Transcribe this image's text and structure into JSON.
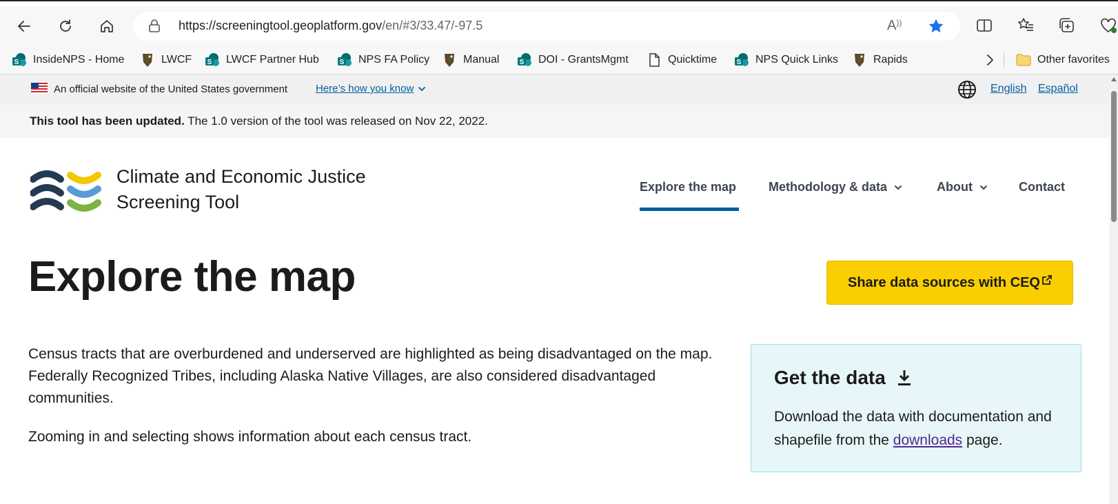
{
  "browser": {
    "url_host": "https://screeningtool.geoplatform.gov",
    "url_path": "/en/#3/33.47/-97.5",
    "read_aloud_label": "A",
    "favorites": [
      {
        "label": "InsideNPS - Home",
        "icon": "sharepoint-icon"
      },
      {
        "label": "LWCF",
        "icon": "nps-arrowhead-icon"
      },
      {
        "label": "LWCF Partner Hub",
        "icon": "sharepoint-icon"
      },
      {
        "label": "NPS FA Policy",
        "icon": "sharepoint-icon"
      },
      {
        "label": "Manual",
        "icon": "nps-arrowhead-icon"
      },
      {
        "label": "DOI - GrantsMgmt",
        "icon": "sharepoint-icon"
      },
      {
        "label": "Quicktime",
        "icon": "document-icon"
      },
      {
        "label": "NPS Quick Links",
        "icon": "sharepoint-icon"
      },
      {
        "label": "Rapids",
        "icon": "nps-arrowhead-icon"
      }
    ],
    "other_favorites": "Other favorites"
  },
  "gov_banner": {
    "text": "An official website of the United States government",
    "link": "Here’s how you know",
    "lang_english": "English",
    "lang_spanish": "Español"
  },
  "update_notice": {
    "bold": "This tool has been updated.",
    "text": " The 1.0 version of the tool was released on Nov 22, 2022."
  },
  "header": {
    "title_line1": "Climate and Economic Justice",
    "title_line2": "Screening Tool",
    "nav": {
      "explore": "Explore the map",
      "methodology": "Methodology & data",
      "about": "About",
      "contact": "Contact"
    }
  },
  "main": {
    "heading": "Explore the map",
    "share_button": "Share data sources with CEQ",
    "intro": "Census tracts that are overburdened and underserved are highlighted as being disadvantaged on the map. Federally Recognized Tribes, including Alaska Native Villages, are also considered disadvantaged communities.",
    "intro2": "Zooming in and selecting shows information about each census tract."
  },
  "get_data_card": {
    "title": "Get the data",
    "body_before": "Download the data with documentation and shapefile from the ",
    "link": "downloads",
    "body_after": " page."
  },
  "colors": {
    "accent_blue": "#005ea2",
    "button_yellow": "#face00",
    "card_bg": "#e7f6f8",
    "link_visited": "#54278f",
    "logo_navy": "#233a53",
    "logo_yellow": "#f2c800",
    "logo_blue": "#5b9bd5",
    "logo_green": "#7cb342"
  }
}
